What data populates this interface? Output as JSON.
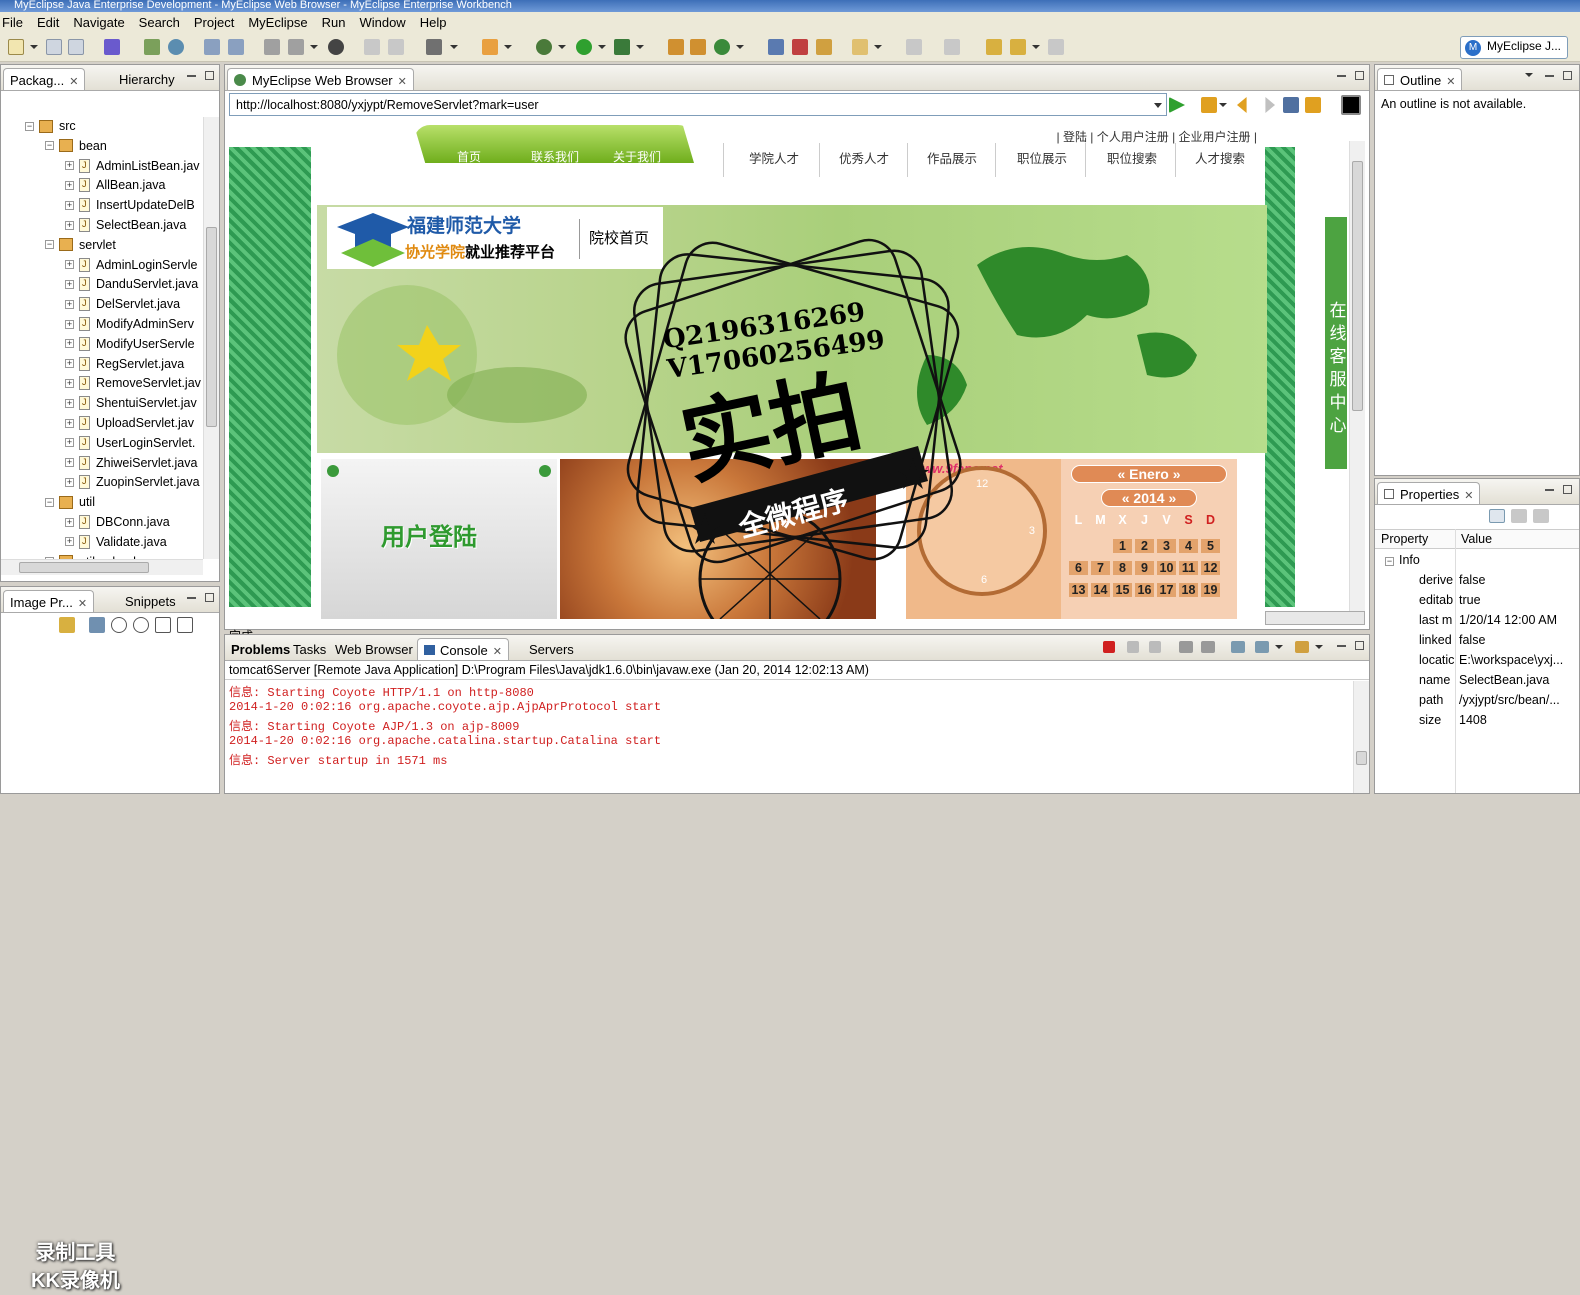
{
  "window": {
    "title": "MyEclipse Java Enterprise Development - MyEclipse Web Browser - MyEclipse Enterprise Workbench"
  },
  "menu": [
    "File",
    "Edit",
    "Navigate",
    "Search",
    "Project",
    "MyEclipse",
    "Run",
    "Window",
    "Help"
  ],
  "perspective": {
    "label": "MyEclipse J..."
  },
  "package_explorer": {
    "tabs": [
      "Packag...",
      "Hierarchy"
    ],
    "items": [
      {
        "label": "src",
        "depth": 0,
        "kind": "pkgroot"
      },
      {
        "label": "bean",
        "depth": 1,
        "kind": "pkg"
      },
      {
        "label": "AdminListBean.jav",
        "depth": 2,
        "kind": "file"
      },
      {
        "label": "AllBean.java",
        "depth": 2,
        "kind": "file"
      },
      {
        "label": "InsertUpdateDelB",
        "depth": 2,
        "kind": "file"
      },
      {
        "label": "SelectBean.java",
        "depth": 2,
        "kind": "file"
      },
      {
        "label": "servlet",
        "depth": 1,
        "kind": "pkg"
      },
      {
        "label": "AdminLoginServle",
        "depth": 2,
        "kind": "file"
      },
      {
        "label": "DanduServlet.java",
        "depth": 2,
        "kind": "file"
      },
      {
        "label": "DelServlet.java",
        "depth": 2,
        "kind": "file"
      },
      {
        "label": "ModifyAdminServ",
        "depth": 2,
        "kind": "file"
      },
      {
        "label": "ModifyUserServle",
        "depth": 2,
        "kind": "file"
      },
      {
        "label": "RegServlet.java",
        "depth": 2,
        "kind": "file"
      },
      {
        "label": "RemoveServlet.jav",
        "depth": 2,
        "kind": "file"
      },
      {
        "label": "ShentuiServlet.jav",
        "depth": 2,
        "kind": "file"
      },
      {
        "label": "UploadServlet.jav",
        "depth": 2,
        "kind": "file"
      },
      {
        "label": "UserLoginServlet.",
        "depth": 2,
        "kind": "file"
      },
      {
        "label": "ZhiweiServlet.java",
        "depth": 2,
        "kind": "file"
      },
      {
        "label": "ZuopinServlet.java",
        "depth": 2,
        "kind": "file"
      },
      {
        "label": "util",
        "depth": 1,
        "kind": "pkg"
      },
      {
        "label": "DBConn.java",
        "depth": 2,
        "kind": "file"
      },
      {
        "label": "Validate.java",
        "depth": 2,
        "kind": "file"
      },
      {
        "label": "util.upload",
        "depth": 1,
        "kind": "pkg"
      }
    ]
  },
  "image_preview": {
    "tabs": [
      "Image Pr...",
      "Snippets"
    ]
  },
  "browser": {
    "tab": "MyEclipse Web Browser",
    "url": "http://localhost:8080/yxjypt/RemoveServlet?mark=user",
    "status": "完成",
    "page": {
      "top_links": "| 登陆 | 个人用户注册 | 企业用户注册 |",
      "nav_green": [
        "首页",
        "联系我们",
        "关于我们"
      ],
      "nav_white": [
        "学院人才",
        "优秀人才",
        "作品展示",
        "职位展示",
        "职位搜索",
        "人才搜索"
      ],
      "logo_title": "福建师范大学",
      "logo_sub_a": "协光学院",
      "logo_sub_b": "就业推荐平台",
      "logo_home": "院校首页",
      "login_box": "用户登陆",
      "promo_text": "www.9fans.net",
      "calendar": {
        "month": "Enero",
        "year": "2014",
        "weekdays": [
          "L",
          "M",
          "X",
          "J",
          "V",
          "S",
          "D"
        ],
        "rows": [
          [
            "",
            "",
            "",
            "1",
            "2",
            "3",
            "4",
            "5"
          ],
          [
            "6",
            "7",
            "8",
            "9",
            "10",
            "11",
            "12"
          ],
          [
            "13",
            "14",
            "15",
            "16",
            "17",
            "18",
            "19"
          ]
        ]
      },
      "clock_numbers": [
        "12",
        "3",
        "6"
      ],
      "online_service": "在线客服中心"
    }
  },
  "stamp": {
    "qq": "Q2196316269",
    "v": "V17060256499",
    "main": "实拍",
    "ribbon": "全微程序"
  },
  "console": {
    "tabs": [
      "Problems",
      "Tasks",
      "Web Browser",
      "Console",
      "Servers"
    ],
    "header": "tomcat6Server [Remote Java Application] D:\\Program Files\\Java\\jdk1.6.0\\bin\\javaw.exe (Jan 20, 2014 12:02:13 AM)",
    "lines": [
      "信息: Starting Coyote HTTP/1.1 on http-8080",
      "2014-1-20 0:02:16 org.apache.coyote.ajp.AjpAprProtocol start",
      "信息: Starting Coyote AJP/1.3 on ajp-8009",
      "2014-1-20 0:02:16 org.apache.catalina.startup.Catalina start",
      "信息: Server startup in 1571 ms"
    ]
  },
  "outline": {
    "tab": "Outline",
    "message": "An outline is not available."
  },
  "properties": {
    "tab": "Properties",
    "headers": [
      "Property",
      "Value"
    ],
    "group": "Info",
    "rows": [
      {
        "k": "derive",
        "v": "false"
      },
      {
        "k": "editab",
        "v": "true"
      },
      {
        "k": "last m",
        "v": "1/20/14 12:00 AM"
      },
      {
        "k": "linked",
        "v": "false"
      },
      {
        "k": "locatic",
        "v": "E:\\workspace\\yxj..."
      },
      {
        "k": "name",
        "v": "SelectBean.java"
      },
      {
        "k": "path",
        "v": "/yxjypt/src/bean/..."
      },
      {
        "k": "size",
        "v": "1408"
      }
    ]
  },
  "recorder_watermark": [
    "录制工具",
    "KK录像机"
  ]
}
